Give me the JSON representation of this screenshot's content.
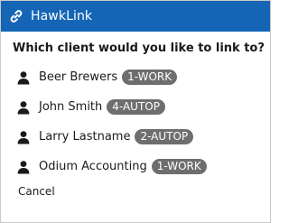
{
  "header": {
    "app_title": "HawkLink",
    "icon": "link-icon",
    "background_color": "#1565b6"
  },
  "prompt": "Which client would you like to link to?",
  "clients": [
    {
      "icon": "person-icon",
      "name": "Beer Brewers",
      "badge": "1-WORK"
    },
    {
      "icon": "person-icon",
      "name": "John Smith",
      "badge": "4-AUTOP"
    },
    {
      "icon": "person-icon",
      "name": "Larry Lastname",
      "badge": "2-AUTOP"
    },
    {
      "icon": "person-icon",
      "name": "Odium Accounting",
      "badge": "1-WORK"
    }
  ],
  "badge_color": "#6e6e6e",
  "cancel_label": "Cancel"
}
